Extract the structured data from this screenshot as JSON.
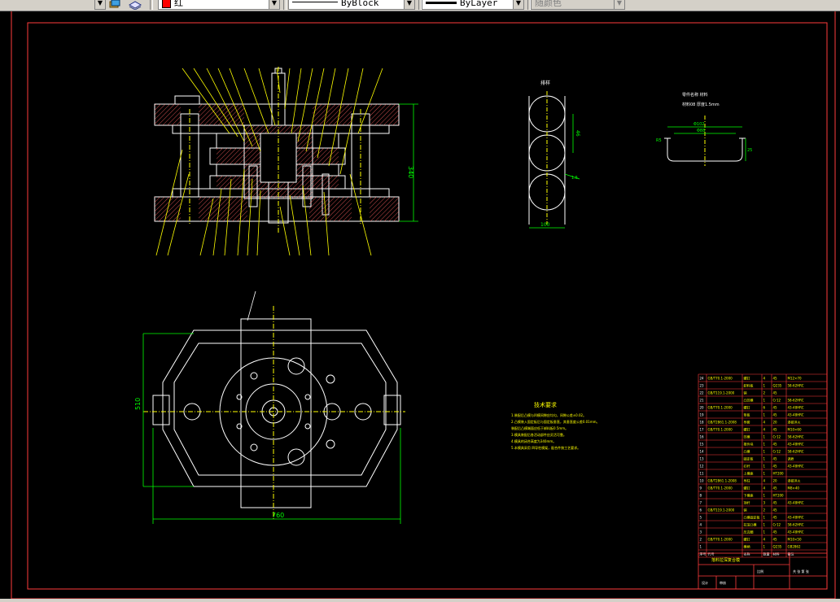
{
  "toolbar": {
    "color_value": "红",
    "linetype_value": "ByBlock",
    "lineweight_value": "ByLayer",
    "plotstyle_value": "随颜色"
  },
  "colors": {
    "frame": "#ff3b3b",
    "geometry": "#ffffff",
    "dimension": "#00ff00",
    "leader": "#ffff00",
    "text": "#ffff00",
    "hatch": "#ff6060",
    "canvas": "#000000"
  },
  "icons": [
    "dropdown-arrow-icon",
    "layer-state-icon",
    "layer-previous-icon",
    "color-swatch-icon"
  ],
  "drawing": {
    "section_dims": {
      "height": "340"
    },
    "plan_dims": {
      "width": "760",
      "height": "510"
    },
    "strip_label": "排样",
    "strip_dims": {
      "pitch": "46",
      "edge": "1.5",
      "width": "100"
    },
    "part_title": "零件名称 材料",
    "part_subtitle": "材料08 厚度1.5mm",
    "part_dims": {
      "diameter": "Φ102",
      "inner": "Φ88",
      "radius": "R5",
      "height": "25"
    },
    "tech_title": "技术要求",
    "tech_notes": [
      "1.装配后凸模与凹模间隙应均匀，间隙公差±0.02。",
      "2.凸模装入固定板后与固定板垂直，其垂直度公差0.01mm。",
      "  装配后凸模端面应低于卸料板0.5mm。",
      "3.模具装配后各活动部件应灵活可靠。",
      "4.模具的闭合高度为340mm。",
      "5.本模具采用 四导柱模架，配合件按工艺要求。"
    ]
  },
  "bom_rows": [
    [
      "24",
      "GB/T70.1-2000",
      "螺钉",
      "4",
      "45",
      "M12×70"
    ],
    [
      "23",
      "",
      "卸料板",
      "1",
      "Q235",
      "58-62HRC"
    ],
    [
      "22",
      "GB/T119.1-2000",
      "销",
      "2",
      "45",
      ""
    ],
    [
      "21",
      "",
      "凸凹模",
      "1",
      "Cr12",
      "58-62HRC"
    ],
    [
      "20",
      "GB/T70.1-2000",
      "螺钉",
      "6",
      "45",
      "43-48HRC"
    ],
    [
      "19",
      "",
      "垫板",
      "1",
      "45",
      "43-48HRC"
    ],
    [
      "18",
      "GB/T2861.1-2008",
      "导套",
      "4",
      "20",
      "渗碳淬火"
    ],
    [
      "17",
      "GB/T70.1-2000",
      "螺钉",
      "4",
      "45",
      "M10×60"
    ],
    [
      "16",
      "",
      "凹模",
      "1",
      "Cr12",
      "58-62HRC"
    ],
    [
      "15",
      "",
      "推件块",
      "1",
      "45",
      "43-48HRC"
    ],
    [
      "14",
      "",
      "凸模",
      "1",
      "Cr12",
      "58-62HRC"
    ],
    [
      "13",
      "",
      "固定板",
      "1",
      "45",
      "调质"
    ],
    [
      "12",
      "",
      "打杆",
      "1",
      "45",
      "43-48HRC"
    ],
    [
      "11",
      "",
      "上模座",
      "1",
      "HT200",
      ""
    ],
    [
      "10",
      "GB/T2861.1-2008",
      "导柱",
      "4",
      "20",
      "渗碳淬火"
    ],
    [
      "9",
      "GB/T70.1-2000",
      "螺钉",
      "4",
      "45",
      "M8×40"
    ],
    [
      "8",
      "",
      "下模座",
      "1",
      "HT200",
      ""
    ],
    [
      "7",
      "",
      "顶杆",
      "3",
      "45",
      "43-48HRC"
    ],
    [
      "6",
      "GB/T119.1-2000",
      "销",
      "2",
      "45",
      ""
    ],
    [
      "5",
      "",
      "凸模固定板",
      "1",
      "45",
      "43-48HRC"
    ],
    [
      "4",
      "",
      "拉深凸模",
      "1",
      "Cr12",
      "58-62HRC"
    ],
    [
      "3",
      "",
      "压边圈",
      "1",
      "45",
      "43-48HRC"
    ],
    [
      "2",
      "GB/T70.1-2000",
      "螺钉",
      "4",
      "45",
      "M10×50"
    ],
    [
      "1",
      "",
      "模柄",
      "1",
      "Q235",
      "GB2862"
    ]
  ],
  "bom_header": [
    "序号",
    "代号",
    "名称",
    "数量",
    "材料",
    "备注"
  ],
  "title_block": {
    "name": "落料拉深复合模",
    "scale_label": "比例",
    "sheet_label": "共 张 第 张",
    "designer_label": "设计",
    "checker_label": "审核"
  }
}
